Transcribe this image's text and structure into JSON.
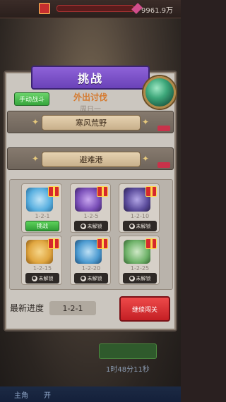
{
  "header": {
    "coins_text": "9961.9万"
  },
  "dialog": {
    "title": "挑战",
    "green_button": "手动战斗",
    "subtitle": "外出讨伐",
    "week_day": "周日一",
    "stages": [
      "寒风荒野",
      "避难港"
    ],
    "levels": [
      {
        "label": "1-2-1",
        "state": "fight",
        "button": "挑战",
        "art_color": "#5ab0e0"
      },
      {
        "label": "1-2-5",
        "state": "locked",
        "button": "未解锁",
        "art_color": "#7a4fb8"
      },
      {
        "label": "1-2-10",
        "state": "locked",
        "button": "未解锁",
        "art_color": "#5b4c9c"
      },
      {
        "label": "1-2-15",
        "state": "locked",
        "button": "未解锁",
        "art_color": "#e0a640"
      },
      {
        "label": "1-2-20",
        "state": "locked",
        "button": "未解锁",
        "art_color": "#4c9ad0"
      },
      {
        "label": "1-2-25",
        "state": "locked",
        "button": "未解锁",
        "art_color": "#6fb36a"
      }
    ],
    "progress_label": "最新进度",
    "progress_value": "1-2-1",
    "continue_button": "继续闯关"
  },
  "background": {
    "timer": "1时48分11秒",
    "bottom_tabs": [
      "主角",
      "开"
    ]
  }
}
